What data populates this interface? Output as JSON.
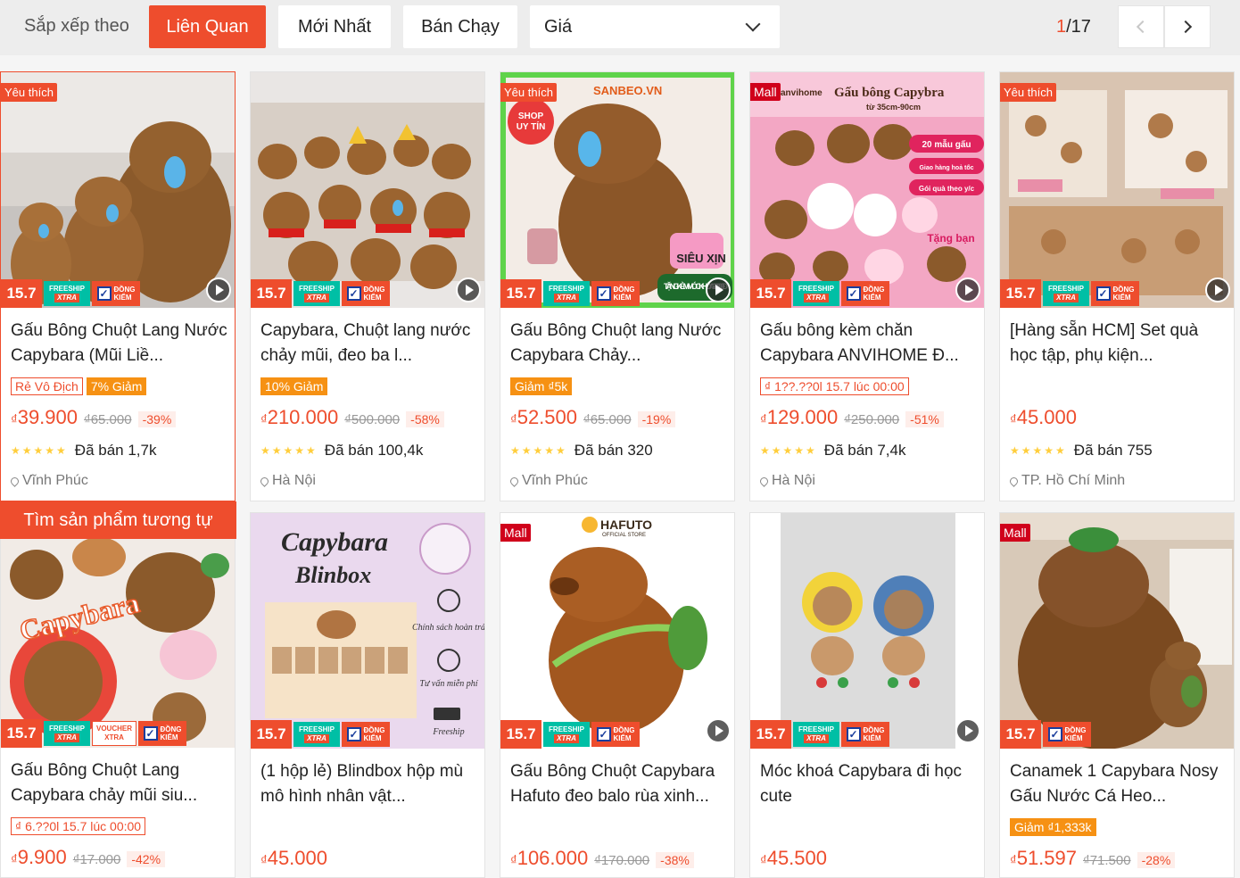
{
  "sortbar": {
    "label": "Sắp xếp theo",
    "options": [
      "Liên Quan",
      "Mới Nhất",
      "Bán Chạy"
    ],
    "price_label": "Giá",
    "page_current": "1",
    "page_total": "/17",
    "accent": "#ee4d2d"
  },
  "common": {
    "date_badge": "15.7",
    "freeship": "FREESHIP",
    "xtra": "XTRA",
    "dongkiem_1": "ĐỒNG",
    "dongkiem_2": "KIỂM",
    "voucher": "VOUCHER",
    "fav_badge": "Yêu thích",
    "mall_badge": "Mall",
    "similar": "Tìm sản phẩm tương tự"
  },
  "products": [
    {
      "title": "Gấu Bông Chuột Lang Nước Capybara (Mũi Liề...",
      "tags": [
        {
          "text": "Rẻ Vô Địch",
          "style": "outline"
        },
        {
          "text": "7% Giảm",
          "style": "fill"
        }
      ],
      "currency": "₫",
      "price": "39.900",
      "old_price": "₫65.000",
      "discount": "-39%",
      "sold": "Đã bán 1,7k",
      "location": "Vĩnh Phúc",
      "badge": "fav"
    },
    {
      "title": "Capybara, Chuột lang nước chảy mũi, đeo ba l...",
      "tags": [
        {
          "text": "10% Giảm",
          "style": "fill"
        }
      ],
      "currency": "₫",
      "price": "210.000",
      "old_price": "₫500.000",
      "discount": "-58%",
      "sold": "Đã bán 100,4k",
      "location": "Hà Nội",
      "badge": ""
    },
    {
      "title": "Gấu Bông Chuột lang Nước Capybara Chảy...",
      "tags": [
        {
          "text": "Giảm ₫5k",
          "style": "fill"
        }
      ],
      "currency": "₫",
      "price": "52.500",
      "old_price": "₫65.000",
      "discount": "-19%",
      "sold": "Đã bán 320",
      "location": "Vĩnh Phúc",
      "badge": "fav"
    },
    {
      "title": "Gấu bông kèm chăn Capybara ANVIHOME Đ...",
      "tags": [
        {
          "text": "₫ 1??.??0l 15.7 lúc 00:00",
          "style": "outline"
        }
      ],
      "currency": "₫",
      "price": "129.000",
      "old_price": "₫250.000",
      "discount": "-51%",
      "sold": "Đã bán 7,4k",
      "location": "Hà Nội",
      "badge": "mall"
    },
    {
      "title": "[Hàng sẵn HCM] Set quà học tập, phụ kiện...",
      "tags": [],
      "currency": "₫",
      "price": "45.000",
      "old_price": "",
      "discount": "",
      "sold": "Đã bán 755",
      "location": "TP. Hồ Chí Minh",
      "badge": "fav"
    },
    {
      "title": "Gấu Bông Chuột Lang Capybara chảy mũi siu...",
      "tags": [
        {
          "text": "₫ 6.??0l 15.7 lúc 00:00",
          "style": "outline"
        }
      ],
      "currency": "₫",
      "price": "9.900",
      "old_price": "₫17.000",
      "discount": "-42%",
      "badge": ""
    },
    {
      "title": "(1 hộp lẻ) Blindbox hộp mù mô hình nhân vật...",
      "tags": [],
      "currency": "₫",
      "price": "45.000",
      "old_price": "",
      "discount": "",
      "badge": ""
    },
    {
      "title": "Gấu Bông Chuột Capybara Hafuto đeo balo rùa xinh...",
      "tags": [],
      "currency": "₫",
      "price": "106.000",
      "old_price": "₫170.000",
      "discount": "-38%",
      "badge": "mall"
    },
    {
      "title": "Móc khoá Capybara đi học cute",
      "tags": [],
      "currency": "₫",
      "price": "45.500",
      "old_price": "",
      "discount": "",
      "badge": ""
    },
    {
      "title": "Canamek 1 Capybara Nosy Gấu Nước Cá Heo...",
      "tags": [
        {
          "text": "Giảm ₫1,333k",
          "style": "fill"
        }
      ],
      "currency": "₫",
      "price": "51.597",
      "old_price": "₫71.500",
      "discount": "-28%",
      "badge": "mall"
    }
  ],
  "image_text": {
    "p3_shop": "SANBEO.VN",
    "p3_shop_badge_1": "SHOP",
    "p3_shop_badge_2": "UY TÍN",
    "p3_sieuxin": "SIÊU XỊN",
    "p3_gift": "TẶNG KÈM MÓC KHÓA 20.000Đ",
    "p4_brand": "anvihome",
    "p4_heading": "Gấu bông Capybra",
    "p4_size": "từ 35cm-90cm",
    "p4_b1": "20 mẫu gấu",
    "p4_b2": "Giao hàng hoả tốc",
    "p4_b3": "Gói quà theo y/c",
    "p4_gift": "Tặng bạn",
    "p6_word": "Capybara",
    "p7_t1": "Capybara",
    "p7_t2": "Blinbox",
    "p7_f1": "Chính sách hoàn trả",
    "p7_f2": "Tư vấn miễn phí",
    "p7_f3": "Freeship",
    "p8_brand": "HAFUTO",
    "p8_sub": "OFFICIAL STORE"
  }
}
